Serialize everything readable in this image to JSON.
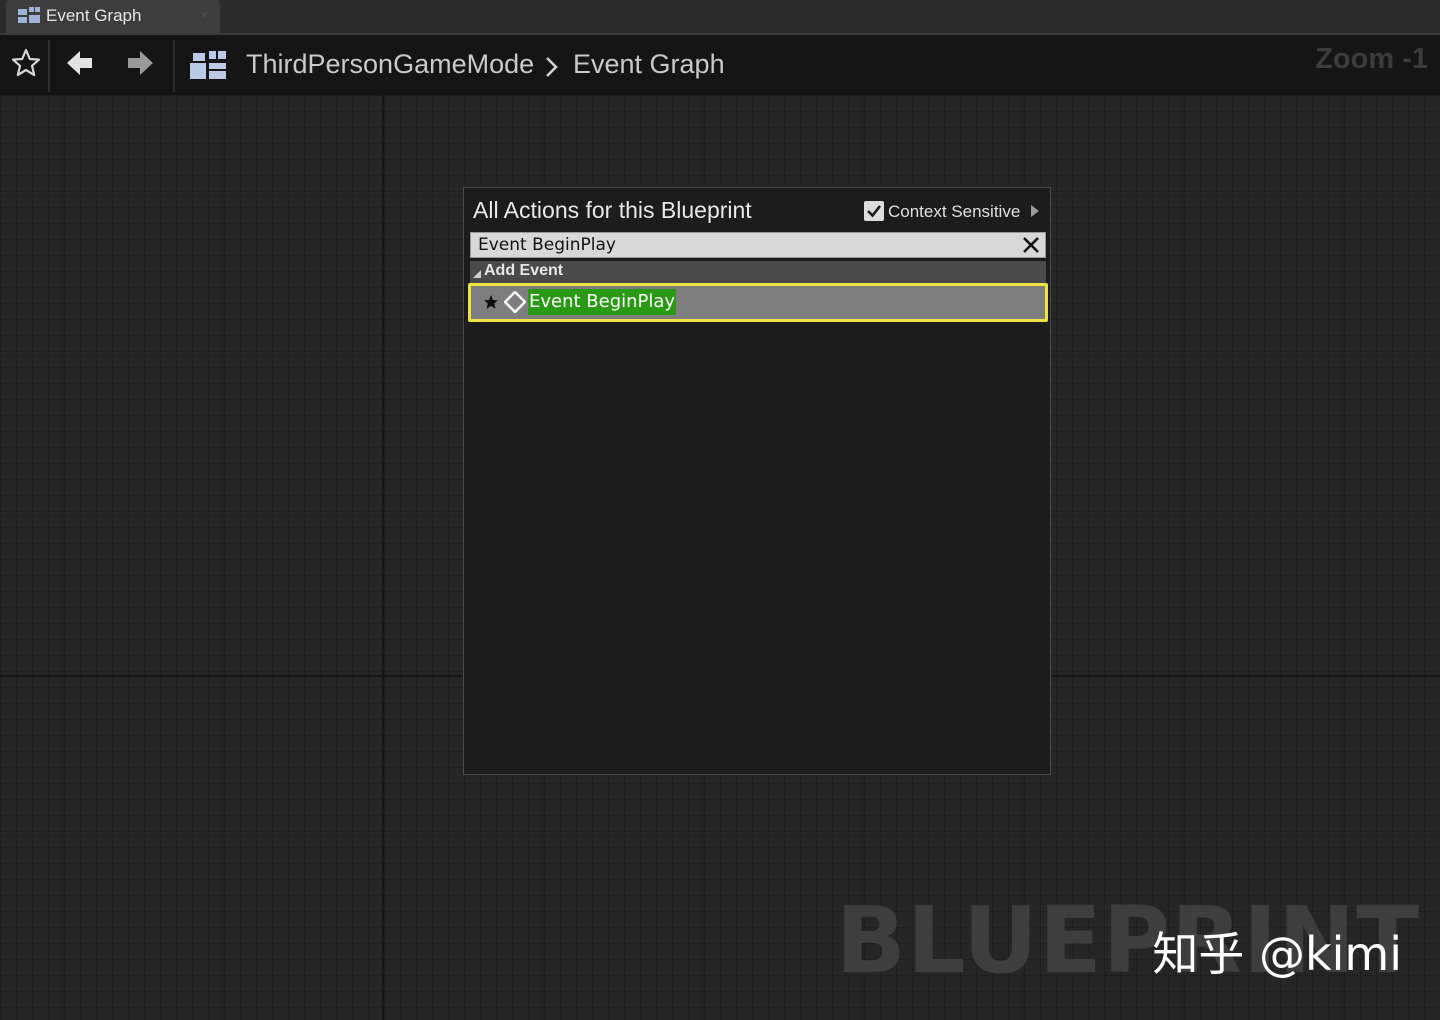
{
  "tab": {
    "label": "Event Graph",
    "icon": "event-graph-icon",
    "close": "×"
  },
  "toolbar": {
    "favorite_icon": "star-outline-icon",
    "back_icon": "arrow-left-icon",
    "forward_icon": "arrow-right-icon",
    "breadcrumb_icon": "event-graph-icon",
    "breadcrumb": [
      "ThirdPersonGameMode",
      "Event Graph"
    ],
    "zoom": "Zoom -1"
  },
  "graph": {
    "watermark": "BLUEPRINT",
    "overlay": "知乎 @kimi"
  },
  "action_menu": {
    "title": "All Actions for this Blueprint",
    "context_sensitive_label": "Context Sensitive",
    "context_sensitive_checked": true,
    "search_value": "Event BeginPlay",
    "clear_icon": "close-icon",
    "category": "Add Event",
    "results": [
      {
        "label": "Event BeginPlay",
        "icon": "event-diamond-icon",
        "favorite": true,
        "selected": true
      }
    ]
  },
  "colors": {
    "highlight": "#2a9a14",
    "selection_border": "#f1e243",
    "background": "#262626"
  }
}
